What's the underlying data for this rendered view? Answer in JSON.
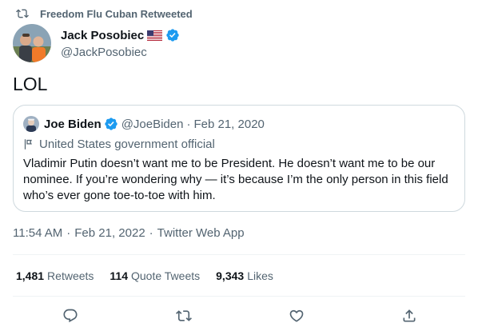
{
  "retweet_context": {
    "text": "Freedom Flu Cuban Retweeted",
    "icon": "retweet-icon"
  },
  "author": {
    "name": "Jack Posobiec",
    "handle": "@JackPosobiec",
    "flag": "us-flag-icon",
    "verified_icon": "verified-badge-icon"
  },
  "tweet": {
    "text": "LOL"
  },
  "quoted_tweet": {
    "name": "Joe Biden",
    "handle": "@JoeBiden",
    "separator": "·",
    "date": "Feb 21, 2020",
    "label": "United States government official",
    "body": "Vladimir Putin doesn’t want me to be President. He doesn’t want me to be our nominee. If you’re wondering why — it’s because I’m the only person in this field who’s ever gone toe-to-toe with him."
  },
  "meta": {
    "time": "11:54 AM",
    "sep": "·",
    "date": "Feb 21, 2022",
    "source": "Twitter Web App"
  },
  "stats": {
    "retweets_count": "1,481",
    "retweets_label": "Retweets",
    "quotes_count": "114",
    "quotes_label": "Quote Tweets",
    "likes_count": "9,343",
    "likes_label": "Likes"
  },
  "colors": {
    "text": "#0f1419",
    "secondary": "#536471",
    "verified": "#1d9bf0",
    "border": "#cfd9de",
    "divider": "#eff3f4"
  }
}
